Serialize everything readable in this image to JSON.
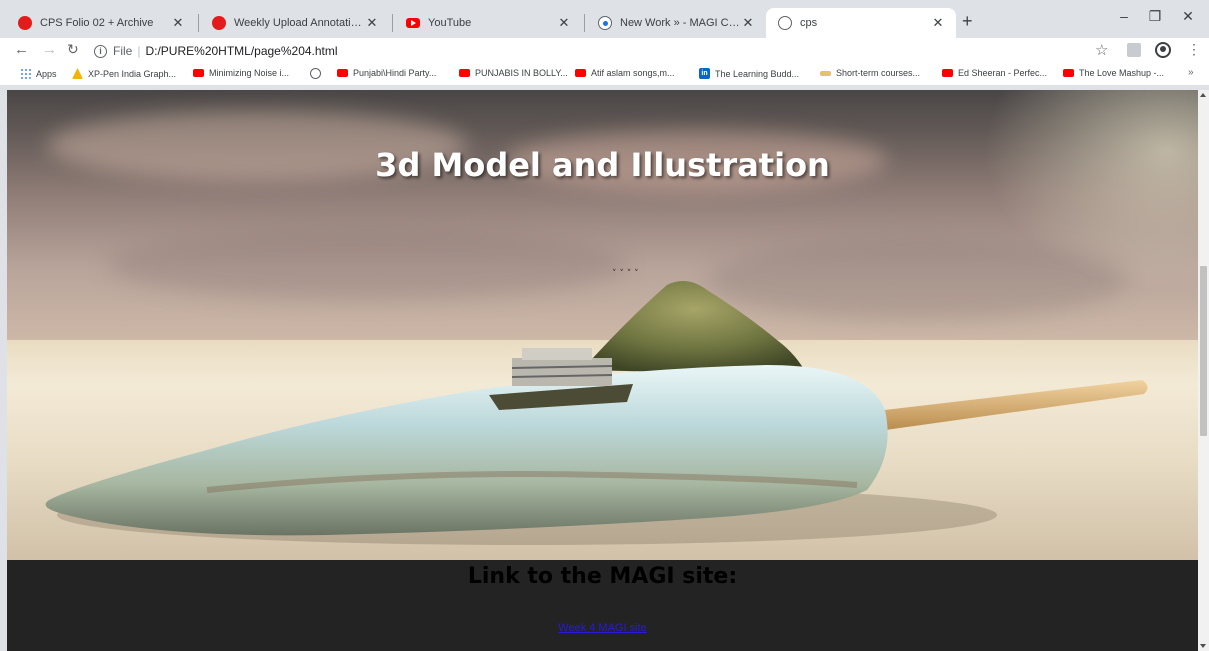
{
  "tabs": [
    {
      "title": "CPS Folio 02 + Archive",
      "favicon": "red-dot-icon"
    },
    {
      "title": "Weekly Upload Annotation Guide",
      "favicon": "red-dot-icon"
    },
    {
      "title": "YouTube",
      "favicon": "youtube-icon"
    },
    {
      "title": "New Work » - MAGI CMS",
      "favicon": "magi-icon"
    },
    {
      "title": "cps",
      "favicon": "globe-icon",
      "active": true
    }
  ],
  "toolbar": {
    "scheme": "File",
    "url": "D:/PURE%20HTML/page%204.html"
  },
  "bookmarks": [
    {
      "label": "Apps",
      "icon": "apps-icon"
    },
    {
      "label": "XP-Pen India Graph...",
      "icon": "xp-pen-icon"
    },
    {
      "label": "Minimizing Noise i...",
      "icon": "youtube-icon"
    },
    {
      "label": "",
      "icon": "globe-icon"
    },
    {
      "label": "Punjabi\\Hindi Party...",
      "icon": "youtube-icon"
    },
    {
      "label": "PUNJABIS IN BOLLY...",
      "icon": "youtube-icon"
    },
    {
      "label": "Atif aslam songs,m...",
      "icon": "youtube-icon"
    },
    {
      "label": "The Learning Budd...",
      "icon": "linkedin-icon"
    },
    {
      "label": "Short-term courses...",
      "icon": "folder-icon"
    },
    {
      "label": "Ed Sheeran - Perfec...",
      "icon": "youtube-icon"
    },
    {
      "label": "The Love Mashup -...",
      "icon": "youtube-icon"
    }
  ],
  "page": {
    "hero_title": "3d Model and Illustration",
    "link_heading": "Link to the MAGI site:",
    "link_text": "Week 4 MAGI site"
  },
  "colors": {
    "link": "#2a1bd6",
    "page_background": "#232323",
    "tabstrip": "#dee1e6"
  }
}
